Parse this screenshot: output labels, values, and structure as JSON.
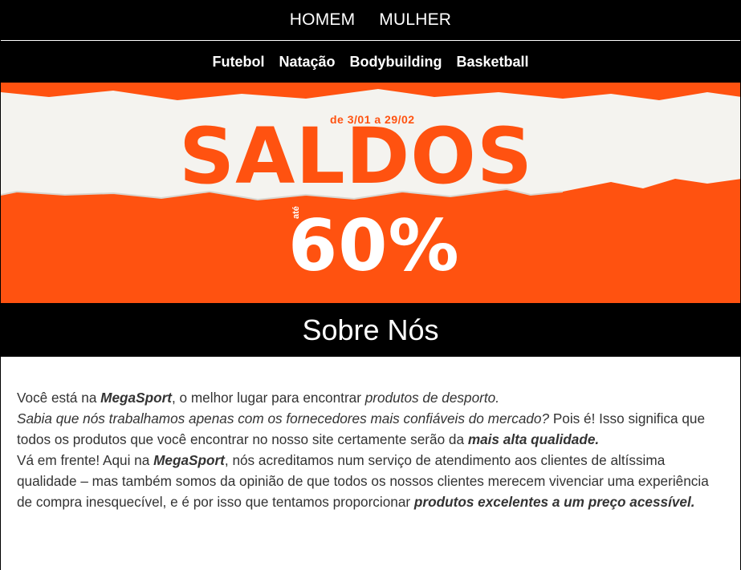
{
  "nav": {
    "primary": [
      "HOMEM",
      "MULHER"
    ],
    "secondary": [
      "Futebol",
      "Natação",
      "Bodybuilding",
      "Basketball"
    ]
  },
  "banner": {
    "dates": "de 3/01 a 29/02",
    "headline": "SALDOS",
    "prefix": "até",
    "discount": "60%",
    "colors": {
      "accent": "#ff5210",
      "paper": "#f4f3ef"
    }
  },
  "about": {
    "title": "Sobre Nós",
    "p1_a": "Você está na ",
    "p1_brand": "MegaSport",
    "p1_b": ", o melhor lugar para encontrar ",
    "p1_c": "produtos de desporto.",
    "p2_italic": "Sabia que nós trabalhamos apenas com os fornecedores mais confiáveis do mercado?",
    "p2_b": " Pois é! Isso significa que todos os produtos que você encontrar no nosso site certamente serão da ",
    "p2_strong": "mais alta qualidade.",
    "p3_a": "Vá em frente! Aqui na ",
    "p3_brand": "MegaSport",
    "p3_b": ", nós acreditamos num serviço de atendimento aos clientes de altíssima qualidade – mas também somos da opinião de que todos os nossos clientes merecem vivenciar uma experiência de compra inesquecível, e é por isso que tentamos proporcionar ",
    "p3_strong": "produtos excelentes a um preço acessível."
  }
}
